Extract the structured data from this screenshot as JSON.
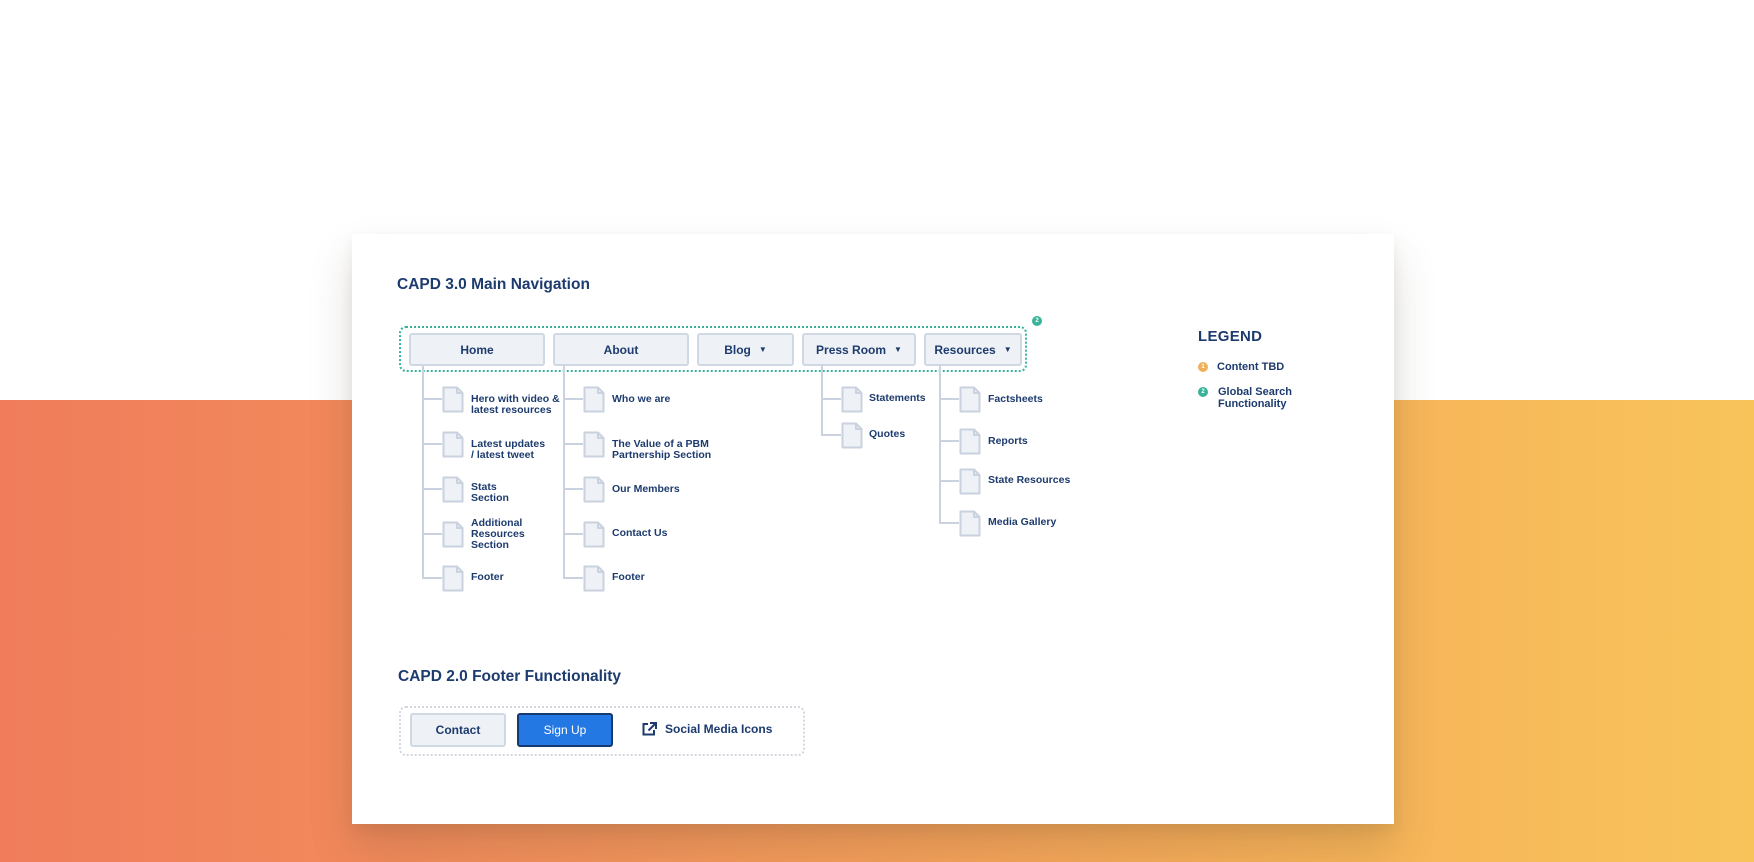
{
  "main_nav": {
    "title": "CAPD 3.0 Main Navigation",
    "frame_marker": "2",
    "items": [
      {
        "label": "Home",
        "has_dropdown": false,
        "children": [
          "Hero with video & latest resources",
          "Latest updates / latest tweet",
          "Stats Section",
          "Additional Resources Section",
          "Footer"
        ]
      },
      {
        "label": "About",
        "has_dropdown": false,
        "children": [
          "Who we are",
          "The Value of a PBM Partnership Section",
          "Our Members",
          "Contact Us",
          "Footer"
        ]
      },
      {
        "label": "Blog",
        "has_dropdown": true,
        "children": []
      },
      {
        "label": "Press Room",
        "has_dropdown": true,
        "children": [
          "Statements",
          "Quotes"
        ]
      },
      {
        "label": "Resources",
        "has_dropdown": true,
        "children": [
          "Factsheets",
          "Reports",
          "State Resources",
          "Media Gallery"
        ]
      }
    ]
  },
  "legend": {
    "title": "LEGEND",
    "items": [
      {
        "marker": "1",
        "label": "Content TBD",
        "color": "#f0b05a"
      },
      {
        "marker": "2",
        "label": "Global Search Functionality",
        "color": "#3ab39a"
      }
    ]
  },
  "footer": {
    "title": "CAPD 2.0 Footer Functionality",
    "contact_label": "Contact",
    "signup_label": "Sign Up",
    "social_label": "Social Media Icons"
  },
  "colors": {
    "navy": "#1d3b6e",
    "accent_blue": "#2478e4",
    "teal": "#3ab39a",
    "amber": "#f0b05a"
  },
  "icons": {
    "page": "page-icon",
    "external_link": "external-link-icon",
    "dropdown": "caret-down-icon"
  }
}
